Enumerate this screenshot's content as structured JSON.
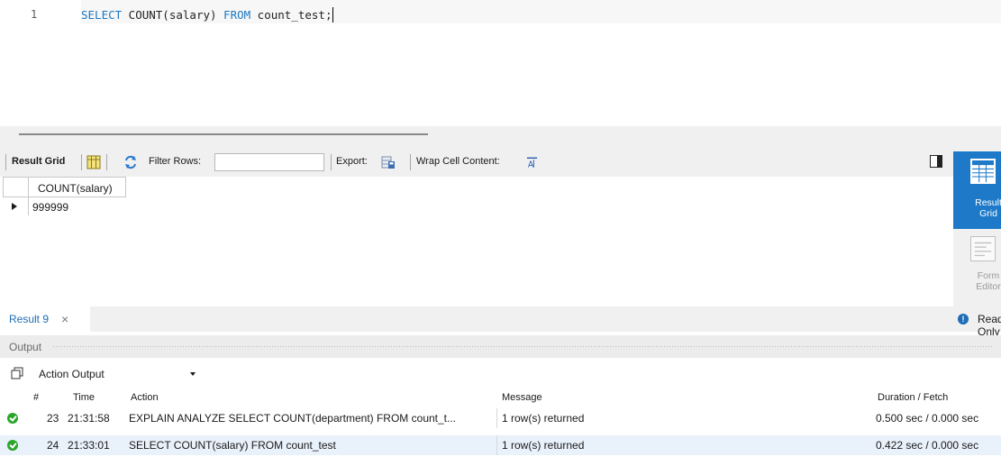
{
  "editor": {
    "line_number": "1",
    "code_tokens": [
      {
        "text": "SELECT",
        "kind": "keyword"
      },
      {
        "text": " COUNT(salary) ",
        "kind": "plain"
      },
      {
        "text": "FROM",
        "kind": "keyword"
      },
      {
        "text": " count_test;",
        "kind": "plain"
      }
    ]
  },
  "result_toolbar": {
    "result_grid_label": "Result Grid",
    "filter_rows_label": "Filter Rows:",
    "filter_value": "",
    "export_label": "Export:",
    "wrap_label": "Wrap Cell Content:"
  },
  "result_grid": {
    "columns": [
      "COUNT(salary)"
    ],
    "rows": [
      [
        "999999"
      ]
    ]
  },
  "side_panel": {
    "result_grid_btn": "Result Grid",
    "form_editor_btn": "Form Editor"
  },
  "result_tab": {
    "label": "Result 9",
    "close": "×",
    "read_only": "Read Only"
  },
  "output": {
    "header": "Output",
    "mode": "Action Output",
    "columns": {
      "num": "#",
      "time": "Time",
      "action": "Action",
      "message": "Message",
      "duration": "Duration / Fetch"
    },
    "rows": [
      {
        "num": "23",
        "time": "21:31:58",
        "action": "EXPLAIN ANALYZE SELECT COUNT(department) FROM count_t...",
        "message": "1 row(s) returned",
        "duration": "0.500 sec / 0.000 sec",
        "status": "success"
      },
      {
        "num": "24",
        "time": "21:33:01",
        "action": "SELECT COUNT(salary) FROM count_test",
        "message": "1 row(s) returned",
        "duration": "0.422 sec / 0.000 sec",
        "status": "success"
      }
    ]
  },
  "colors": {
    "keyword": "#1d78c1",
    "accent": "#1e7ac8",
    "success": "#2aa52a",
    "selected_row": "#e9f1fb"
  }
}
